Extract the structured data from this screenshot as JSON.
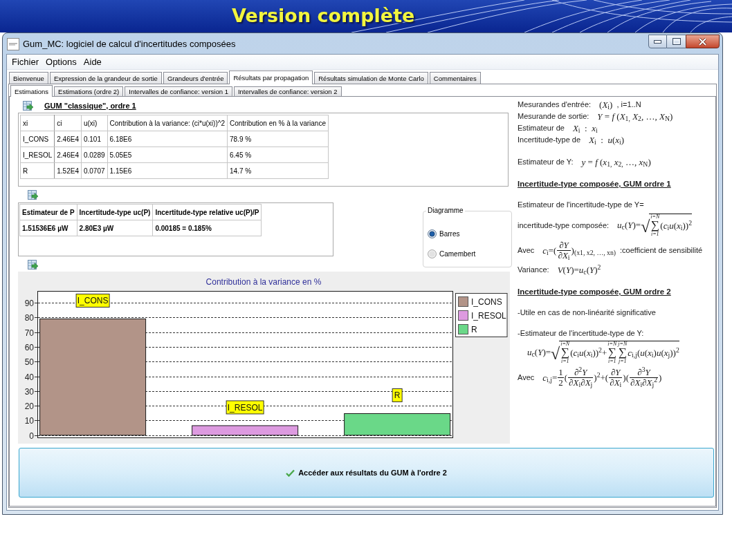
{
  "slide": {
    "title": "Version complète"
  },
  "window": {
    "title": "Gum_MC: logiciel de calcul d'incertitudes composées"
  },
  "menu": [
    "Fichier",
    "Options",
    "Aide"
  ],
  "tabs": [
    {
      "label": "Bienvenue",
      "selected": false
    },
    {
      "label": "Expression de la grandeur de sortie",
      "selected": false
    },
    {
      "label": "Grandeurs d'entrée",
      "selected": false
    },
    {
      "label": "Résultats par propagation",
      "selected": true
    },
    {
      "label": "Résultats simulation de Monte Carlo",
      "selected": false
    },
    {
      "label": "Commentaires",
      "selected": false
    }
  ],
  "subtabs": [
    {
      "label": "Estimations",
      "selected": true
    },
    {
      "label": "Estimations (ordre 2)",
      "selected": false
    },
    {
      "label": "Intervalles de confiance: version 1",
      "selected": false
    },
    {
      "label": "Intervalles de confiance: version 2",
      "selected": false
    }
  ],
  "sensitivity_table": {
    "title": "GUM \"classique\", ordre 1",
    "columns": [
      "xi",
      "ci",
      "u(xi)",
      "Contribution à la variance: (ci*u(xi))^2",
      "Contribution en % à la variance"
    ],
    "rows": [
      [
        "I_CONS",
        "2.46E4",
        "0.101",
        "6.18E6",
        "78.9 %"
      ],
      [
        "I_RESOL",
        "2.46E4",
        "0.0289",
        "5.05E5",
        "6.45 %"
      ],
      [
        "R",
        "1.52E4",
        "0.0707",
        "1.15E6",
        "14.7 %"
      ]
    ]
  },
  "result_table": {
    "columns": [
      "Estimateur de P",
      "Incertitude-type uc(P)",
      "Incertitude-type relative uc(P)/P"
    ],
    "rows": [
      [
        "1.51536E6 µW",
        "2.80E3 µW",
        "0.00185 = 0.185%"
      ]
    ]
  },
  "diagram": {
    "title": "Diagramme",
    "options": [
      {
        "label": "Barres",
        "selected": true
      },
      {
        "label": "Camembert",
        "selected": false
      }
    ]
  },
  "chart": {
    "chart_data": {
      "type": "bar",
      "title": "Contribution à la variance en %",
      "categories": [
        "I_CONS",
        "I_RESOL",
        "R"
      ],
      "series": [
        {
          "name": "I_CONS",
          "color": "#b29488",
          "values": [
            79,
            null,
            null
          ]
        },
        {
          "name": "I_RESOL",
          "color": "#dd9ae0",
          "values": [
            null,
            6.5,
            null
          ]
        },
        {
          "name": "R",
          "color": "#6ad888",
          "values": [
            null,
            null,
            14.7
          ]
        }
      ],
      "ylim": [
        -1.5,
        98
      ],
      "yticks": [
        0,
        10,
        20,
        30,
        40,
        50,
        60,
        70,
        80,
        90
      ],
      "grid": true,
      "legend": true
    }
  },
  "theory": [
    {
      "items": [
        {
          "kind": "row",
          "label": "Mesurandes d'entrée:",
          "formula": [
            {
              "kind": "t",
              "text": "(*X*$_{i}$)"
            }
          ],
          "note": ", i=1..N"
        },
        {
          "kind": "row",
          "label": "Mesurande de sortie:",
          "formula": [
            {
              "kind": "t",
              "text": "*Y* = *f* (*X*$_{1,}$ *X*$_{2}$, …, *X*$_{N}$)"
            }
          ]
        },
        {
          "kind": "row",
          "label": "Estimateur de",
          "formula": [
            {
              "kind": "t",
              "text": "*X*$_{i}$  :  *x*$_{i}$"
            }
          ]
        },
        {
          "kind": "row",
          "label": "Incertitude-type de",
          "formula": [
            {
              "kind": "t",
              "text": "*X*$_{i}$  :  *u*(*x*$_{i}$)"
            }
          ]
        }
      ]
    },
    {
      "items": [
        {
          "kind": "row",
          "label": "Estimateur de Y:",
          "formula": [
            {
              "kind": "t",
              "text": "*y* = *f* (*x*$_{1,}$ *x*$_{2,}$ …, *x*$_{N}$)"
            }
          ]
        }
      ]
    },
    {
      "heading": "Incertitude-type composée, GUM ordre 1",
      "items": [
        {
          "kind": "text",
          "text": "Estimateur de l'incertitude-type de Y="
        },
        {
          "kind": "row",
          "label": "incertitude-type composée:",
          "formula": [
            {
              "kind": "t",
              "text": "*u*$_{c}$(*Y*)="
            },
            {
              "kind": "sqrt",
              "sign": "√",
              "body": [
                {
                  "kind": "sum",
                  "sign": "∑",
                  "over": "i=N",
                  "under": "i=1"
                },
                {
                  "kind": "t",
                  "text": "(*c*$_{i}$*u*(*x*$_{i}$))$^{2}$"
                }
              ]
            }
          ]
        },
        {
          "kind": "row",
          "label": "Avec",
          "formula": [
            {
              "kind": "t",
              "text": "*c*$_{i}$=("
            },
            {
              "kind": "frac",
              "num": [
                {
                  "kind": "t",
                  "text": "∂*Y*"
                }
              ],
              "den": [
                {
                  "kind": "t",
                  "text": "∂*X*$_{i}$"
                }
              ]
            },
            {
              "kind": "t",
              "text": ")$_{(x1, x2, …, xn)}$"
            }
          ],
          "note": ":coefficient de sensibilité"
        },
        {
          "kind": "row",
          "label": "Variance:",
          "formula": [
            {
              "kind": "t",
              "text": "*V*(*Y*)=*u*$_{c}$(*Y*)$^{2}$"
            }
          ]
        }
      ]
    },
    {
      "heading": "Incertitude-type composée, GUM ordre 2",
      "items": [
        {
          "kind": "text",
          "text": "-Utile en cas de non-linéarité significative"
        },
        {
          "kind": "text",
          "text": "-Estimateur de l'incertitude-type de Y:"
        },
        {
          "kind": "equation",
          "formula": [
            {
              "kind": "t",
              "text": "*u*$_{c}$(*Y*)="
            },
            {
              "kind": "sqrt",
              "sign": "√",
              "body": [
                {
                  "kind": "sum",
                  "sign": "∑",
                  "over": "i=N",
                  "under": "i=1"
                },
                {
                  "kind": "t",
                  "text": "(*c*$_{i}$*u*(*x*$_{i}$))$^{2}$+"
                },
                {
                  "kind": "sum",
                  "sign": "∑",
                  "over": "i=N",
                  "under": "i=1"
                },
                {
                  "kind": "sum",
                  "sign": "∑",
                  "over": "j=N",
                  "under": "j=1"
                },
                {
                  "kind": "t",
                  "text": "*c*$_{i,j}$(*u*(*x*$_{i}$)*u*(*x*$_{j}$))$^{2}$"
                }
              ]
            }
          ]
        },
        {
          "kind": "row",
          "label": "Avec",
          "formula": [
            {
              "kind": "t",
              "text": "*c*$_{i,j}$="
            },
            {
              "kind": "frac",
              "num": [
                {
                  "kind": "t",
                  "text": "1"
                }
              ],
              "den": [
                {
                  "kind": "t",
                  "text": "2"
                }
              ]
            },
            {
              "kind": "t",
              "text": "("
            },
            {
              "kind": "frac",
              "num": [
                {
                  "kind": "t",
                  "text": "∂$^{2}$*Y*"
                }
              ],
              "den": [
                {
                  "kind": "t",
                  "text": "∂*X*$_{i}$∂*X*$_{j}$"
                }
              ]
            },
            {
              "kind": "t",
              "text": ")$^{2}$+("
            },
            {
              "kind": "frac",
              "num": [
                {
                  "kind": "t",
                  "text": "∂*Y*"
                }
              ],
              "den": [
                {
                  "kind": "t",
                  "text": "∂*X*$_{i}$"
                }
              ]
            },
            {
              "kind": "t",
              "text": ")("
            },
            {
              "kind": "frac",
              "num": [
                {
                  "kind": "t",
                  "text": "∂$^{3}$*Y*"
                }
              ],
              "den": [
                {
                  "kind": "t",
                  "text": "∂*X*$_{i}$∂*X*$_{j}$$^{2}$"
                }
              ]
            },
            {
              "kind": "t",
              "text": ")"
            }
          ]
        }
      ]
    }
  ],
  "action_button": {
    "label": "Accéder aux résultats du GUM à l'ordre 2"
  }
}
